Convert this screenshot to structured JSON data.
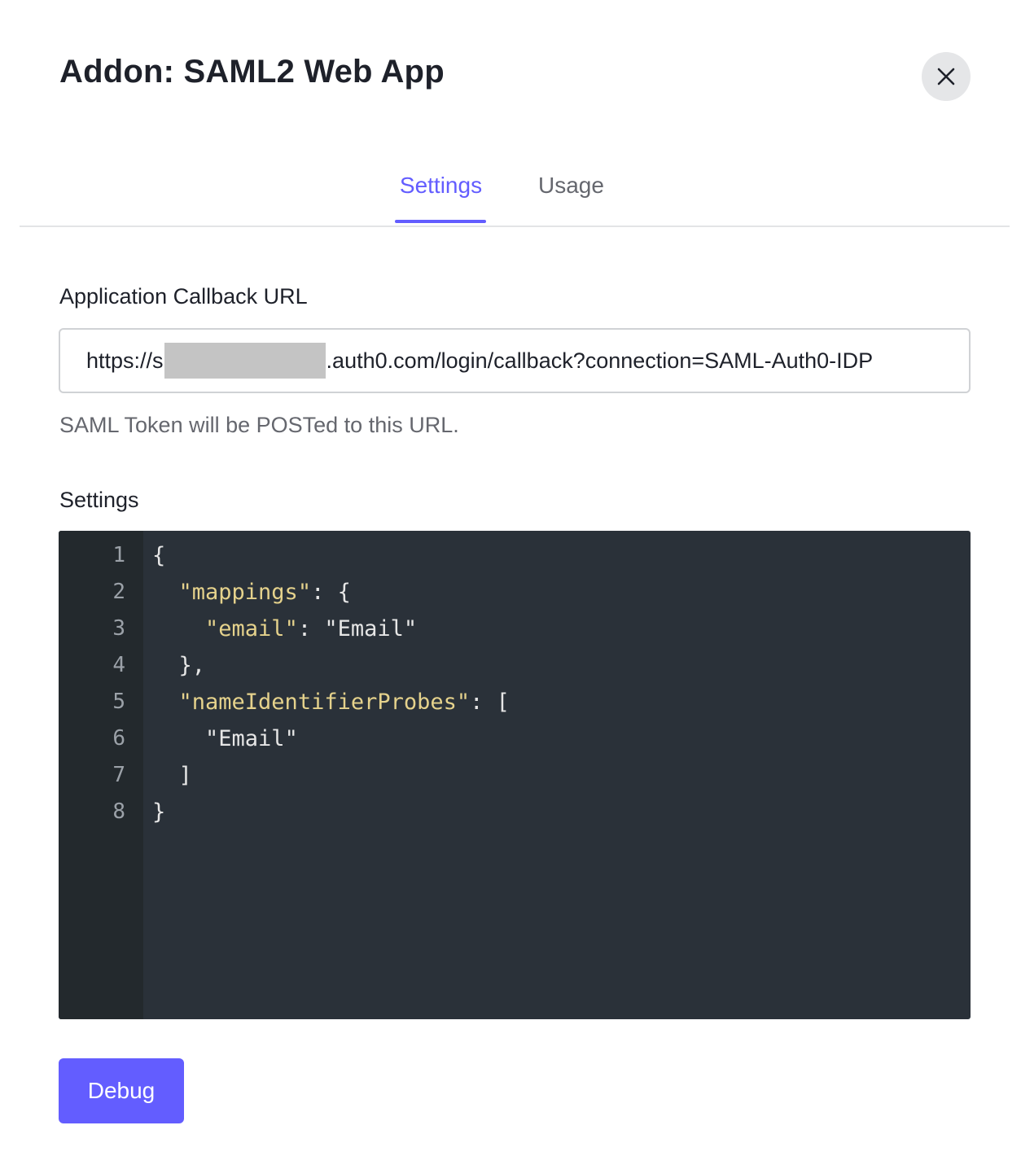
{
  "modal": {
    "title": "Addon: SAML2 Web App",
    "close_icon": "close-icon"
  },
  "tabs": [
    {
      "label": "Settings",
      "active": true
    },
    {
      "label": "Usage",
      "active": false
    }
  ],
  "callback": {
    "label": "Application Callback URL",
    "value_prefix": "https://s",
    "value_suffix": ".auth0.com/login/callback?connection=SAML-Auth0-IDP",
    "help": "SAML Token will be POSTed to this URL."
  },
  "settings": {
    "label": "Settings",
    "line_numbers": [
      "1",
      "2",
      "3",
      "4",
      "5",
      "6",
      "7",
      "8"
    ],
    "code": {
      "l1": "{",
      "l2_key": "\"mappings\"",
      "l2_rest": ": {",
      "l3_key": "\"email\"",
      "l3_colon": ": ",
      "l3_val": "\"Email\"",
      "l4": "},",
      "l5_key": "\"nameIdentifierProbes\"",
      "l5_rest": ": [",
      "l6_val": "\"Email\"",
      "l7": "]",
      "l8": "}"
    }
  },
  "actions": {
    "debug_label": "Debug"
  },
  "colors": {
    "accent": "#635dff",
    "editor_bg": "#2a3139",
    "gutter_bg": "#23292d",
    "json_key": "#e5d28c"
  }
}
